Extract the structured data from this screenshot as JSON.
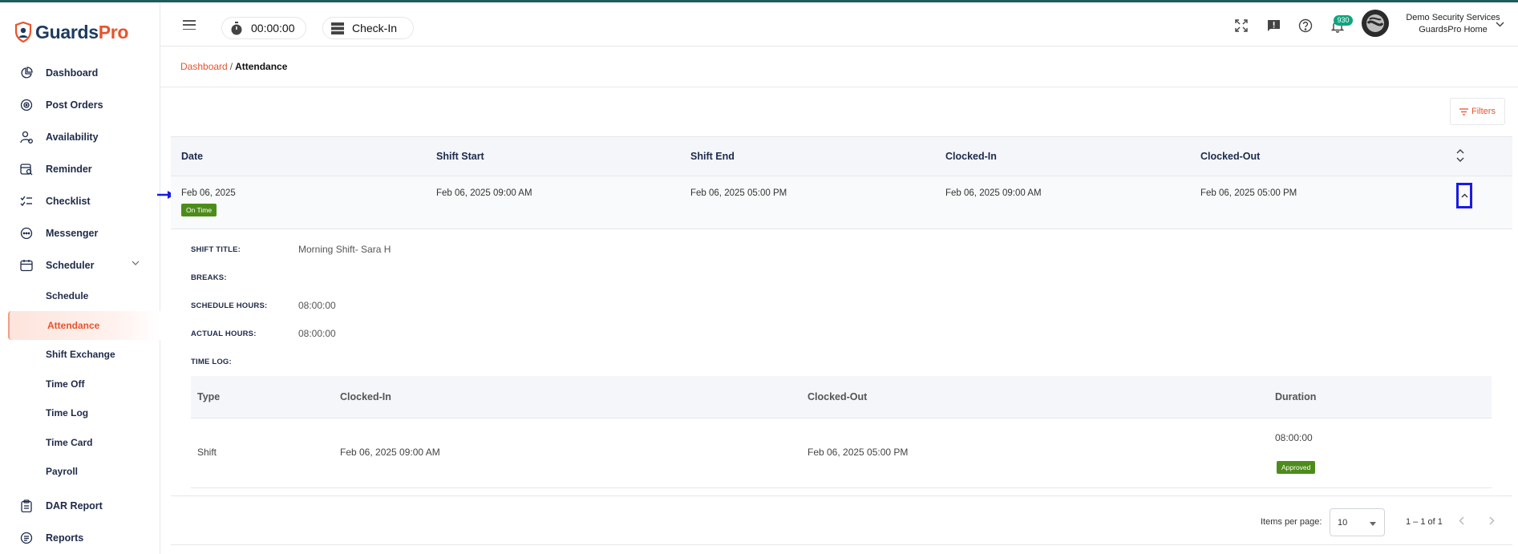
{
  "app": {
    "logo_part1": "Guards",
    "logo_part2": "Pro"
  },
  "sidebar": {
    "items": [
      {
        "label": "Dashboard",
        "icon": "pie-chart-icon"
      },
      {
        "label": "Post Orders",
        "icon": "target-icon"
      },
      {
        "label": "Availability",
        "icon": "user-clock-icon"
      },
      {
        "label": "Reminder",
        "icon": "calendar-search-icon"
      },
      {
        "label": "Checklist",
        "icon": "checklist-icon"
      },
      {
        "label": "Messenger",
        "icon": "chat-bubble-icon"
      },
      {
        "label": "Scheduler",
        "icon": "calendar-icon"
      }
    ],
    "scheduler_sub": [
      {
        "label": "Schedule"
      },
      {
        "label": "Attendance",
        "active": true
      },
      {
        "label": "Shift Exchange"
      },
      {
        "label": "Time Off"
      },
      {
        "label": "Time Log"
      },
      {
        "label": "Time Card"
      },
      {
        "label": "Payroll"
      }
    ],
    "bottom_items": [
      {
        "label": "DAR Report",
        "icon": "clipboard-icon"
      },
      {
        "label": "Reports",
        "icon": "report-list-icon"
      }
    ]
  },
  "header": {
    "timer": "00:00:00",
    "checkin_label": "Check-In",
    "notification_count": "930",
    "company_name": "Demo Security Services",
    "site_name": "GuardsPro Home"
  },
  "breadcrumb": {
    "parent": "Dashboard",
    "separator": "/",
    "current": "Attendance"
  },
  "filters_label": "Filters",
  "table": {
    "columns": [
      "Date",
      "Shift Start",
      "Shift End",
      "Clocked-In",
      "Clocked-Out"
    ],
    "row": {
      "date": "Feb 06, 2025",
      "status": "On Time",
      "shift_start": "Feb 06, 2025 09:00 AM",
      "shift_end": "Feb 06, 2025 05:00 PM",
      "clocked_in": "Feb 06, 2025 09:00 AM",
      "clocked_out": "Feb 06, 2025 05:00 PM"
    }
  },
  "detail": {
    "shift_title_label": "SHIFT TITLE:",
    "shift_title": "Morning Shift- Sara H",
    "breaks_label": "BREAKS:",
    "schedule_hours_label": "SCHEDULE HOURS:",
    "schedule_hours": "08:00:00",
    "actual_hours_label": "ACTUAL HOURS:",
    "actual_hours": "08:00:00",
    "time_log_label": "TIME LOG:",
    "log_columns": [
      "Type",
      "Clocked-In",
      "Clocked-Out",
      "Duration"
    ],
    "log_row": {
      "type": "Shift",
      "clocked_in": "Feb 06, 2025 09:00 AM",
      "clocked_out": "Feb 06, 2025 05:00 PM",
      "duration": "08:00:00",
      "status": "Approved"
    }
  },
  "paginator": {
    "items_per_page_label": "Items per page:",
    "items_per_page": "10",
    "range": "1 – 1 of 1"
  },
  "colors": {
    "accent": "#e8532b",
    "navy": "#1e2a4a",
    "success": "#4d8c1b",
    "badge": "#10a37f",
    "annotation": "#1a1ae6"
  }
}
